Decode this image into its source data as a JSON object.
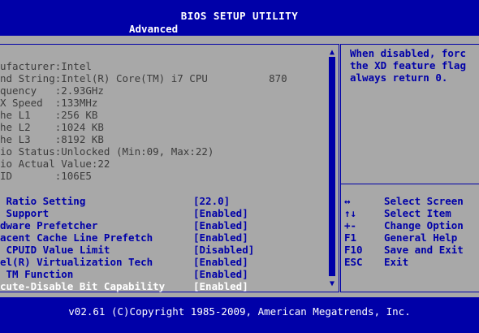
{
  "header": {
    "title": "BIOS SETUP UTILITY"
  },
  "menu": {
    "active_tab": "Advanced"
  },
  "info_rows": [
    "ufacturer:Intel",
    "nd String:Intel(R) Core(TM) i7 CPU          870",
    "quency   :2.93GHz",
    "X Speed  :133MHz",
    "he L1    :256 KB",
    "he L2    :1024 KB",
    "he L3    :8192 KB",
    "io Status:Unlocked (Min:09, Max:22)",
    "io Actual Value:22",
    "ID       :106E5"
  ],
  "settings": [
    {
      "label": " Ratio Setting",
      "value": "[22.0]"
    },
    {
      "label": " Support",
      "value": "[Enabled]"
    },
    {
      "label": "dware Prefetcher",
      "value": "[Enabled]"
    },
    {
      "label": "acent Cache Line Prefetch",
      "value": "[Enabled]"
    },
    {
      "label": " CPUID Value Limit",
      "value": "[Disabled]"
    },
    {
      "label": "el(R) Virtualization Tech",
      "value": "[Enabled]"
    },
    {
      "label": " TM Function",
      "value": "[Enabled]"
    },
    {
      "label": "cute-Disable Bit Capability",
      "value": "[Enabled]",
      "selected": true
    }
  ],
  "help": {
    "lines": [
      "When disabled, forc",
      "the XD feature flag",
      "always return 0."
    ]
  },
  "keys": [
    {
      "key": "↔",
      "action": "Select Screen"
    },
    {
      "key": "↑↓",
      "action": "Select Item"
    },
    {
      "key": "+-",
      "action": "Change Option"
    },
    {
      "key": "F1",
      "action": "General Help"
    },
    {
      "key": "F10",
      "action": "Save and Exit"
    },
    {
      "key": "ESC",
      "action": "Exit"
    }
  ],
  "footer": {
    "copyright": "v02.61 (C)Copyright 1985-2009, American Megatrends, Inc."
  },
  "colors": {
    "bios_blue": "#0000a8",
    "panel_gray": "#a8a8a8",
    "info_text": "#3c3c3c",
    "white": "#ffffff"
  }
}
